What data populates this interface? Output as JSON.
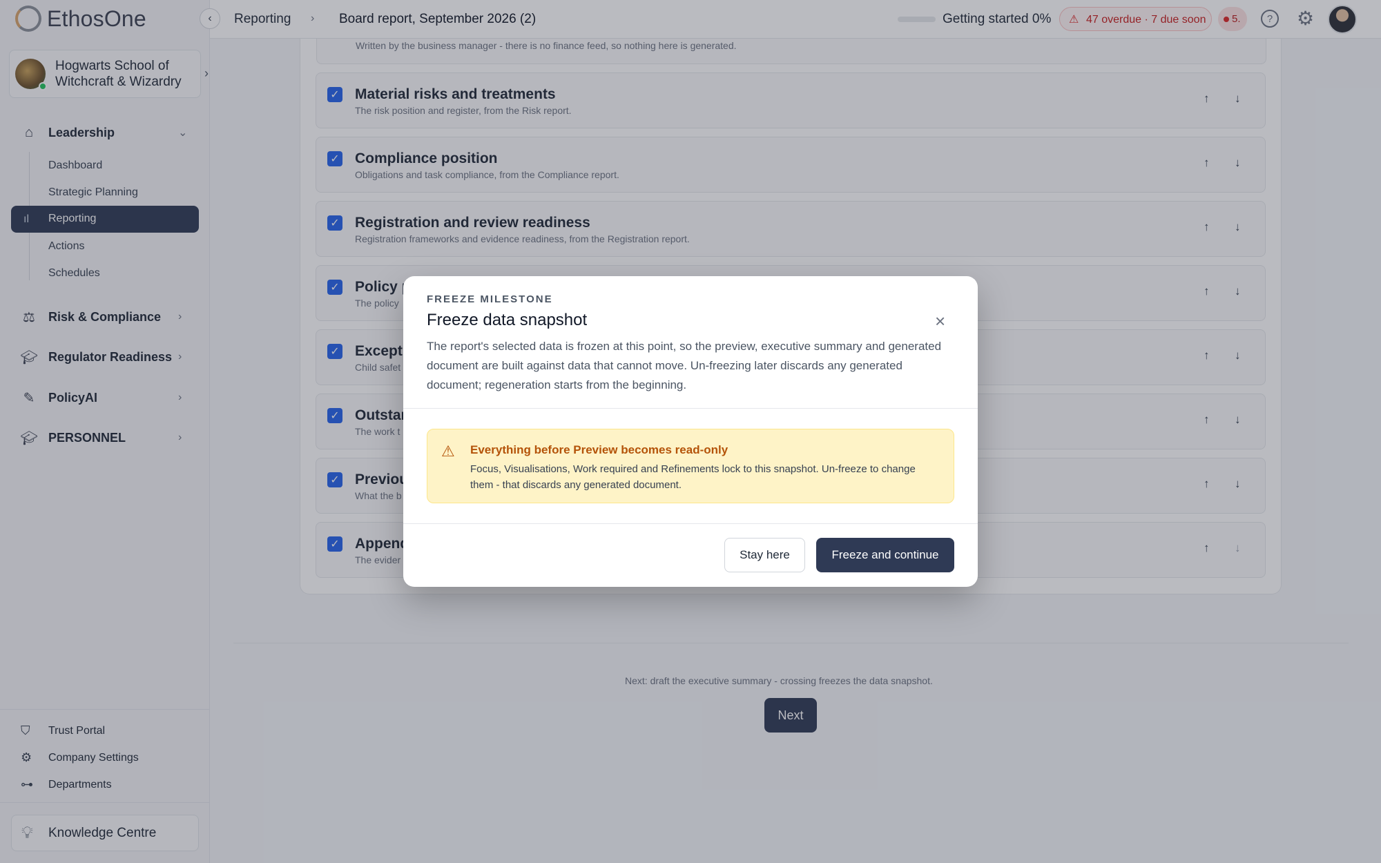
{
  "app": {
    "name": "EthosOne"
  },
  "school": {
    "name_line1": "Hogwarts School of",
    "name_line2": "Witchcraft & Wizardry"
  },
  "sidebar": {
    "sections": [
      {
        "label": "Leadership",
        "icon": "home-icon"
      },
      {
        "label": "Risk & Compliance",
        "icon": "scales-icon"
      },
      {
        "label": "Regulator Readiness",
        "icon": "graduation-cap-icon"
      },
      {
        "label": "PolicyAI",
        "icon": "pen-icon"
      },
      {
        "label": "PERSONNEL",
        "icon": "graduation-cap-icon"
      }
    ],
    "leadership_items": [
      "Dashboard",
      "Strategic Planning",
      "Reporting",
      "Actions",
      "Schedules"
    ],
    "active_item": "Reporting",
    "footer_items": [
      {
        "label": "Trust Portal",
        "icon": "shield-check-icon"
      },
      {
        "label": "Company Settings",
        "icon": "gear-icon"
      },
      {
        "label": "Departments",
        "icon": "org-chart-icon"
      }
    ],
    "knowledge_centre": "Knowledge Centre"
  },
  "topbar": {
    "breadcrumb_1": "Reporting",
    "breadcrumb_2": "Board report, September 2026 (2)",
    "getting_started": "Getting started 0%",
    "getting_started_progress": 0,
    "alert": "47 overdue · 7 due soon",
    "count_badge": "5."
  },
  "sections": {
    "partial_desc": "Written by the business manager - there is no finance feed, so nothing here is generated.",
    "rows": [
      {
        "title": "Material risks and treatments",
        "desc": "The risk position and register, from the Risk report."
      },
      {
        "title": "Compliance position",
        "desc": "Obligations and task compliance, from the Compliance report."
      },
      {
        "title": "Registration and review readiness",
        "desc": "Registration frameworks and evidence readiness, from the Registration report."
      },
      {
        "title": "Policy p",
        "desc": "The policy"
      },
      {
        "title": "Excepti",
        "desc": "Child safet"
      },
      {
        "title": "Outstan",
        "desc": "The work t"
      },
      {
        "title": "Previou",
        "desc": "What the b"
      },
      {
        "title": "Append",
        "desc": "The evider"
      }
    ]
  },
  "footer": {
    "hint": "Next: draft the executive summary - crossing freezes the data snapshot.",
    "next_label": "Next"
  },
  "modal": {
    "eyebrow": "FREEZE MILESTONE",
    "title": "Freeze data snapshot",
    "description": "The report's selected data is frozen at this point, so the preview, executive summary and generated document are built against data that cannot move. Un-freezing later discards any generated document; regeneration starts from the beginning.",
    "warning_title": "Everything before Preview becomes read-only",
    "warning_body": "Focus, Visualisations, Work required and Refinements lock to this snapshot. Un-freeze to change them - that discards any generated document.",
    "stay_label": "Stay here",
    "freeze_label": "Freeze and continue"
  }
}
